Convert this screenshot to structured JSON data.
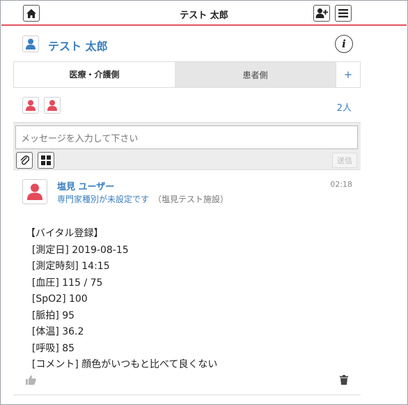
{
  "header": {
    "title": "テスト 太郎",
    "icons": [
      "home-icon",
      "add-user-icon",
      "menu-icon"
    ]
  },
  "profile": {
    "name": "テスト 太郎",
    "info_icon": "i"
  },
  "tabs": [
    {
      "label": "医療・介護側",
      "active": true
    },
    {
      "label": "患者側",
      "active": false
    },
    {
      "label": "+",
      "active": false
    }
  ],
  "members": {
    "count_label": "2人",
    "avatar_color": "#e34a5a"
  },
  "compose": {
    "placeholder": "メッセージを入力して下さい",
    "send_label": "送信"
  },
  "post": {
    "author": "塩見 ユーザー",
    "role": "専門家種別が未設定です",
    "facility": "（塩見テスト施設）",
    "time": "02:18",
    "lines": [
      "【バイタル登録】",
      "  [測定日] 2019-08-15",
      "  [測定時刻] 14:15",
      "  [血圧] 115 / 75",
      "  [SpO2] 100",
      "  [脈拍] 95",
      "  [体温] 36.2",
      "  [呼吸] 85",
      "  [コメント] 顔色がいつもと比べて良くない"
    ]
  },
  "colors": {
    "accent": "#3a7fc0",
    "header_line": "#e0525a",
    "person_red": "#e34a5a",
    "person_blue": "#3a7fc0"
  }
}
